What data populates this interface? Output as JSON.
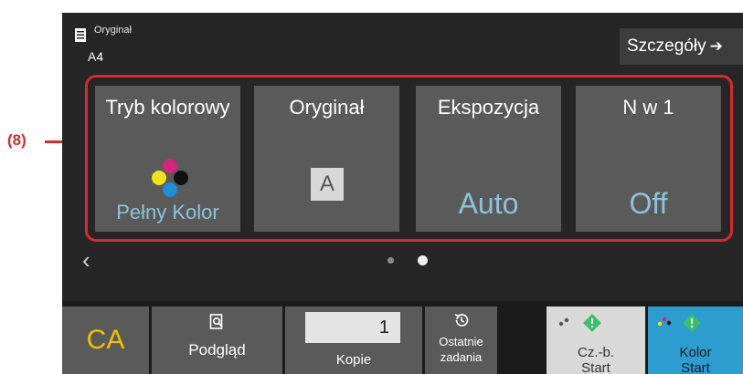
{
  "callout": {
    "label": "(8)",
    "color": "#d9282f"
  },
  "original_info": {
    "title": "Oryginał",
    "size": "A4",
    "icon": "document-icon"
  },
  "details_button": {
    "label": "Szczegóły",
    "arrow": "➔"
  },
  "tiles": [
    {
      "label": "Tryb kolorowy",
      "value": "Pełny Kolor",
      "icon": "color-dots-icon"
    },
    {
      "label": "Oryginał",
      "value": "A",
      "icon": "original-a-icon"
    },
    {
      "label": "Ekspozycja",
      "value": "Auto"
    },
    {
      "label": "N w 1",
      "value": "Off"
    }
  ],
  "pagination": {
    "prev": "‹",
    "current_page": 2,
    "total_pages": 2
  },
  "bottom": {
    "ca_label": "CA",
    "preview_label": "Podgląd",
    "copies_value": "1",
    "copies_label": "Kopie",
    "recent_label_line1": "Ostatnie",
    "recent_label_line2": "zadania",
    "bw_start_line1": "Cz.-b.",
    "bw_start_line2": "Start",
    "color_start_line1": "Kolor",
    "color_start_line2": "Start"
  },
  "colors": {
    "accent_value": "#8ec2dc",
    "ca_text": "#f2c200",
    "color_start_bg": "#2d9ccf",
    "start_diamond": "#3bbf6a"
  }
}
